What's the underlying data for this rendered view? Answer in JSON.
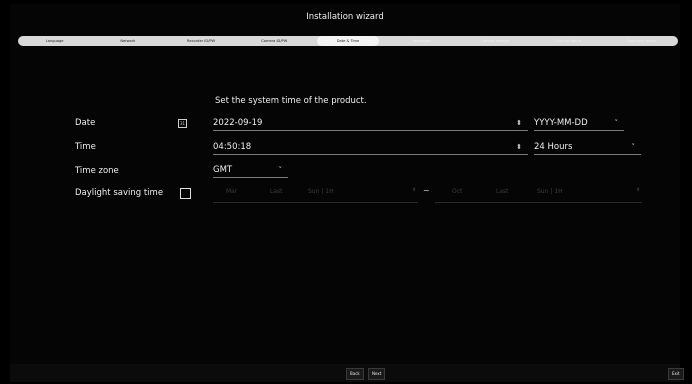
{
  "window": {
    "title": "Installation wizard"
  },
  "steps": [
    {
      "label": "Language",
      "state": "done"
    },
    {
      "label": "Network",
      "state": "done"
    },
    {
      "label": "Recorder ID/PW",
      "state": "done"
    },
    {
      "label": "Camera ID/PW",
      "state": "done"
    },
    {
      "label": "Date & Time",
      "state": "active"
    },
    {
      "label": "Resolution",
      "state": "pending"
    },
    {
      "label": "Camera register",
      "state": "pending"
    },
    {
      "label": "Channel setup",
      "state": "pending"
    },
    {
      "label": "Operation mode",
      "state": "pending"
    }
  ],
  "content": {
    "heading": "Set the system time of the product.",
    "date": {
      "label": "Date",
      "value": "2022-09-19",
      "format": "YYYY-MM-DD"
    },
    "time": {
      "label": "Time",
      "value": "04:50:18",
      "format": "24 Hours"
    },
    "timezone": {
      "label": "Time zone",
      "value": "GMT"
    },
    "dst": {
      "label": "Daylight saving time",
      "checked": false,
      "start": {
        "month": "Mar",
        "week": "Last",
        "day": "Sun | 1H"
      },
      "separator": "~",
      "end": {
        "month": "Oct",
        "week": "Last",
        "day": "Sun | 1H"
      }
    }
  },
  "footer": {
    "back": "Back",
    "next": "Next",
    "exit": "Exit"
  },
  "icons": {
    "calendar": "calendar-icon",
    "spinner": "updown-arrow-icon",
    "dropdown": "dropdown-arrow-icon"
  }
}
